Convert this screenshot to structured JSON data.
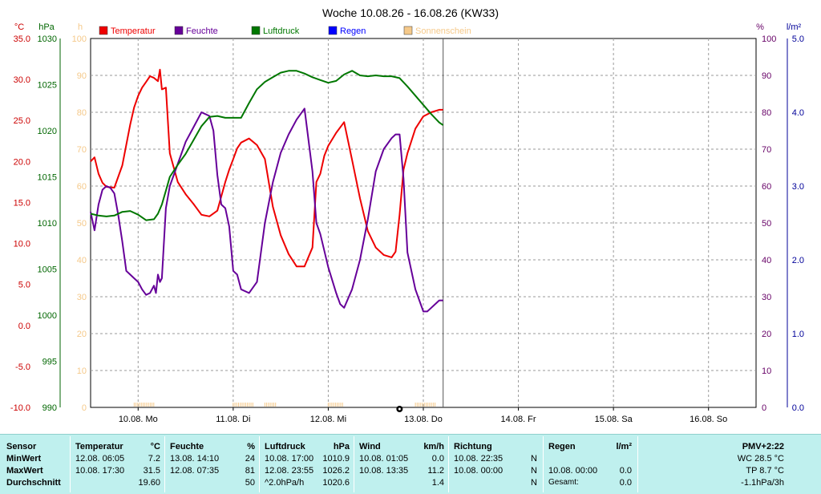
{
  "chart_data": {
    "type": "line",
    "title": "Woche 10.08.26 - 16.08.26 (KW33)",
    "x_ticks": [
      "10.08. Mo",
      "11.08. Di",
      "12.08. Mi",
      "13.08. Do",
      "14.08. Fr",
      "15.08. Sa",
      "16.08. So"
    ],
    "x_unit": "hours since 10.08. 00:00",
    "xlim": [
      0,
      168
    ],
    "data_end_hour": 89,
    "grid": true,
    "legend_position": "top",
    "axes": {
      "temp": {
        "label": "°C",
        "color": "#cc0000",
        "range": [
          -10,
          35
        ],
        "ticks": [
          "-10.0",
          "-5.0",
          "0.0",
          "5.0",
          "10.0",
          "15.0",
          "20.0",
          "25.0",
          "30.0",
          "35.0"
        ]
      },
      "press": {
        "label": "hPa",
        "color": "#006600",
        "range": [
          990,
          1030
        ],
        "ticks": [
          "990",
          "995",
          "1000",
          "1005",
          "1010",
          "1015",
          "1020",
          "1025",
          "1030"
        ]
      },
      "sun": {
        "label": "h",
        "color": "#f5c98a",
        "range": [
          0,
          100
        ],
        "ticks": [
          "0",
          "10",
          "20",
          "30",
          "40",
          "50",
          "60",
          "70",
          "80",
          "90",
          "100"
        ]
      },
      "hum": {
        "label": "%",
        "color": "#660066",
        "range": [
          0,
          100
        ],
        "ticks": [
          "0",
          "10",
          "20",
          "30",
          "40",
          "50",
          "60",
          "70",
          "80",
          "90",
          "100"
        ]
      },
      "rain": {
        "label": "l/m²",
        "color": "#000099",
        "range": [
          0,
          5
        ],
        "ticks": [
          "0.0",
          "1.0",
          "2.0",
          "3.0",
          "4.0",
          "5.0"
        ]
      }
    },
    "series": [
      {
        "name": "Temperatur",
        "axis": "temp",
        "color": "#ee0000",
        "x": [
          0,
          1,
          2,
          3,
          4,
          6,
          8,
          10,
          11,
          12,
          13,
          14,
          15,
          16,
          17,
          17.5,
          18,
          19,
          20,
          22,
          24,
          26,
          28,
          30,
          32,
          34,
          35,
          36,
          37,
          38,
          40,
          42,
          44,
          46,
          48,
          50,
          52,
          54,
          56,
          57,
          58,
          59,
          60,
          62,
          64,
          66,
          68,
          70,
          72,
          74,
          76,
          77,
          78,
          79,
          80,
          82,
          84,
          86,
          88,
          89
        ],
        "y": [
          20.0,
          20.5,
          18.5,
          17.4,
          16.9,
          16.8,
          19.5,
          24.5,
          26.6,
          28.0,
          29.0,
          29.7,
          30.4,
          30.2,
          29.8,
          31.2,
          28.8,
          29.0,
          21.0,
          17.5,
          16.0,
          14.8,
          13.5,
          13.3,
          14.0,
          17.5,
          19.0,
          20.3,
          21.6,
          22.3,
          22.8,
          22.0,
          20.3,
          14.5,
          11.0,
          8.7,
          7.2,
          7.2,
          9.5,
          17.5,
          18.5,
          20.7,
          21.9,
          23.5,
          24.8,
          20.2,
          15.5,
          11.5,
          9.5,
          8.6,
          8.3,
          9.0,
          13.5,
          19.0,
          21.0,
          24.0,
          25.5,
          26.0,
          26.3,
          26.3
        ]
      },
      {
        "name": "Feuchte",
        "axis": "hum",
        "color": "#660099",
        "x": [
          0,
          1,
          2,
          3,
          4,
          5,
          6,
          7,
          8,
          9,
          10,
          11,
          12,
          13,
          14,
          15,
          16,
          16.5,
          17,
          17.5,
          18,
          19,
          20,
          22,
          24,
          26,
          28,
          30,
          31,
          32,
          33,
          34,
          35,
          36,
          37,
          38,
          40,
          42,
          44,
          46,
          48,
          50,
          52,
          54,
          56,
          57,
          58,
          60,
          62,
          63,
          64,
          66,
          68,
          70,
          72,
          74,
          76,
          77,
          78,
          79,
          80,
          82,
          84,
          85,
          86,
          88,
          89
        ],
        "y": [
          53,
          48,
          55,
          59,
          60,
          59.5,
          58,
          52,
          45,
          37,
          36,
          35,
          34,
          32,
          30.5,
          31,
          33,
          31,
          36,
          34,
          35,
          54,
          60,
          66,
          72,
          76,
          80,
          79,
          75,
          63,
          55,
          54,
          49,
          37,
          36,
          32,
          31,
          34,
          50,
          61,
          69,
          74,
          78,
          81,
          64,
          50,
          47,
          38,
          31,
          28,
          27,
          32,
          40,
          51,
          64,
          70,
          73,
          74,
          74,
          62,
          42,
          32,
          26,
          26,
          27,
          29,
          29
        ]
      },
      {
        "name": "Luftdruck",
        "axis": "press",
        "color": "#007700",
        "x": [
          0,
          2,
          4,
          6,
          8,
          10,
          12,
          14,
          16,
          17,
          18,
          19,
          20,
          22,
          24,
          26,
          28,
          30,
          32,
          34,
          36,
          38,
          40,
          42,
          44,
          46,
          48,
          50,
          52,
          54,
          56,
          58,
          60,
          62,
          64,
          66,
          68,
          70,
          72,
          74,
          76,
          78,
          80,
          82,
          84,
          86,
          88,
          89
        ],
        "y": [
          1011.0,
          1010.8,
          1010.7,
          1010.8,
          1011.2,
          1011.3,
          1010.9,
          1010.3,
          1010.4,
          1011.0,
          1012.0,
          1013.5,
          1015.0,
          1016.3,
          1017.5,
          1019.0,
          1020.5,
          1021.5,
          1021.6,
          1021.4,
          1021.4,
          1021.4,
          1023.0,
          1024.5,
          1025.3,
          1025.8,
          1026.3,
          1026.5,
          1026.5,
          1026.2,
          1025.8,
          1025.5,
          1025.2,
          1025.4,
          1026.1,
          1026.5,
          1026.0,
          1025.9,
          1026.0,
          1025.9,
          1025.9,
          1025.7,
          1024.8,
          1023.8,
          1022.8,
          1021.8,
          1020.9,
          1020.6
        ]
      }
    ],
    "sun_marks": [
      [
        11,
        16
      ],
      [
        36,
        41
      ],
      [
        44,
        47
      ],
      [
        60,
        64
      ],
      [
        82,
        87
      ]
    ],
    "regen_values": []
  },
  "legend": [
    {
      "label": "Temperatur",
      "color": "#ee0000"
    },
    {
      "label": "Feuchte",
      "color": "#660099"
    },
    {
      "label": "Luftdruck",
      "color": "#007700"
    },
    {
      "label": "Regen",
      "color": "#0000ff"
    },
    {
      "label": "Sonnenschein",
      "color": "#f5c98a"
    }
  ],
  "stats": {
    "row_labels": [
      "Sensor",
      "MinWert",
      "MaxWert",
      "Durchschnitt"
    ],
    "temperatur": {
      "title": "Temperatur",
      "unit": "°C",
      "rows": [
        [
          "12.08.  06:05",
          "7.2"
        ],
        [
          "10.08.  17:30",
          "31.5"
        ],
        [
          "",
          "19.60"
        ]
      ]
    },
    "feuchte": {
      "title": "Feuchte",
      "unit": "%",
      "rows": [
        [
          "13.08.  14:10",
          "24"
        ],
        [
          "12.08.  07:35",
          "81"
        ],
        [
          "",
          "50"
        ]
      ]
    },
    "luftdruck": {
      "title": "Luftdruck",
      "unit": "hPa",
      "rows": [
        [
          "10.08.  17:00",
          "1010.9"
        ],
        [
          "12.08.  23:55",
          "1026.2"
        ],
        [
          "^2.0hPa/h",
          "1020.6"
        ]
      ]
    },
    "wind": {
      "title": "Wind",
      "unit": "km/h",
      "rows": [
        [
          "10.08.  01:05",
          "0.0"
        ],
        [
          "10.08.  13:35",
          "11.2"
        ],
        [
          "",
          "1.4"
        ]
      ]
    },
    "richtung": {
      "title": "Richtung",
      "rows": [
        [
          "10.08.  22:35",
          "N"
        ],
        [
          "10.08.  00:00",
          "N"
        ],
        [
          "",
          "N"
        ]
      ]
    },
    "regen": {
      "title": "Regen",
      "unit": "l/m²",
      "rows": [
        [
          "",
          ""
        ],
        [
          "10.08.  00:00",
          "0.0"
        ],
        [
          "Gesamt:",
          "0.0"
        ]
      ]
    },
    "pmv": {
      "title": "PMV+2:22",
      "lines": [
        "WC 28.5 °C",
        "TP 8.7 °C",
        "-1.1hPa/3h"
      ]
    }
  }
}
